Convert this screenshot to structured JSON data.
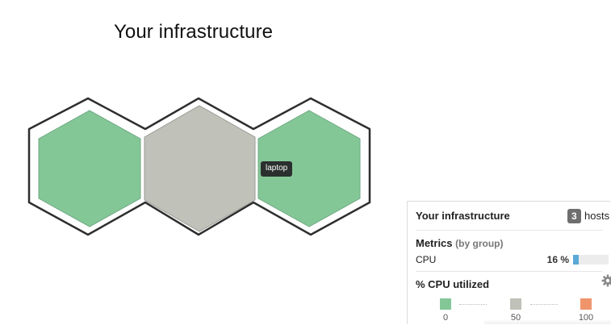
{
  "page": {
    "title": "Your infrastructure"
  },
  "hexmap": {
    "hosts": [
      {
        "id": "host-1",
        "color": "#84c797"
      },
      {
        "id": "host-2",
        "color": "#c0c1b9"
      },
      {
        "id": "host-3",
        "color": "#84c797"
      }
    ],
    "outline_color": "#2e2e2e",
    "tooltip": "laptop"
  },
  "panel": {
    "title": "Your infrastructure",
    "host_count": "3",
    "host_label": "hosts",
    "metrics_heading": "Metrics",
    "metrics_sub": "(by group)",
    "metric": {
      "name": "CPU",
      "value": "16 %",
      "fraction": 0.16
    },
    "legend_heading": "% CPU utilized",
    "legend": [
      {
        "label": "0",
        "color": "#84c797"
      },
      {
        "label": "50",
        "color": "#c0c1b9"
      },
      {
        "label": "100",
        "color": "#ef946b"
      }
    ],
    "icons": {
      "settings": "gear-icon"
    }
  }
}
